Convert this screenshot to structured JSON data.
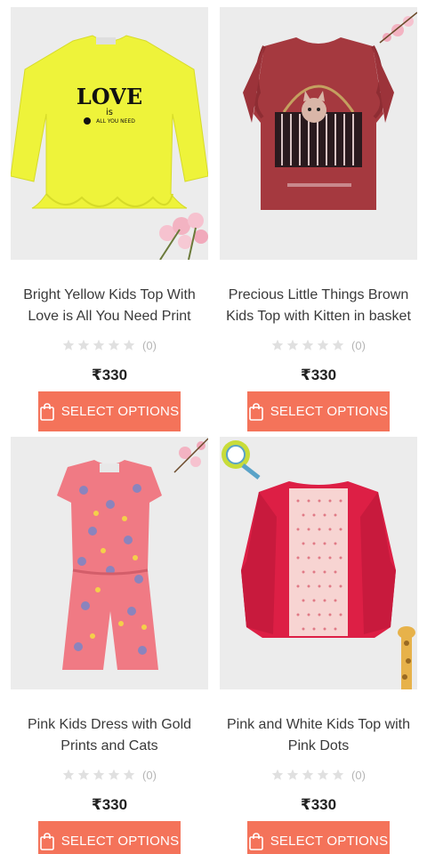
{
  "products": [
    {
      "title": "Bright Yellow Kids Top With Love is All You Need Print",
      "rating_count": "(0)",
      "price": "₹330",
      "button_label": "SELECT OPTIONS",
      "print_text_big": "LOVE",
      "print_text_small": "is",
      "print_text_line": "ALL YOU NEED",
      "garment_color": "#eef33a"
    },
    {
      "title": "Precious Little Things Brown Kids Top with Kitten in basket",
      "rating_count": "(0)",
      "price": "₹330",
      "button_label": "SELECT OPTIONS",
      "garment_color": "#a5393f"
    },
    {
      "title": "Pink Kids Dress with Gold Prints and Cats",
      "rating_count": "(0)",
      "price": "₹330",
      "button_label": "SELECT OPTIONS",
      "garment_color": "#f07a84"
    },
    {
      "title": "Pink and White Kids Top with Pink Dots",
      "rating_count": "(0)",
      "price": "₹330",
      "button_label": "SELECT OPTIONS",
      "garment_color": "#dd1f45"
    }
  ],
  "colors": {
    "accent": "#f4735a",
    "star_empty": "#e0e0e0",
    "thumb_bg": "#ececec"
  },
  "icons": {
    "star": "star-icon",
    "bag": "shopping-bag-icon"
  }
}
